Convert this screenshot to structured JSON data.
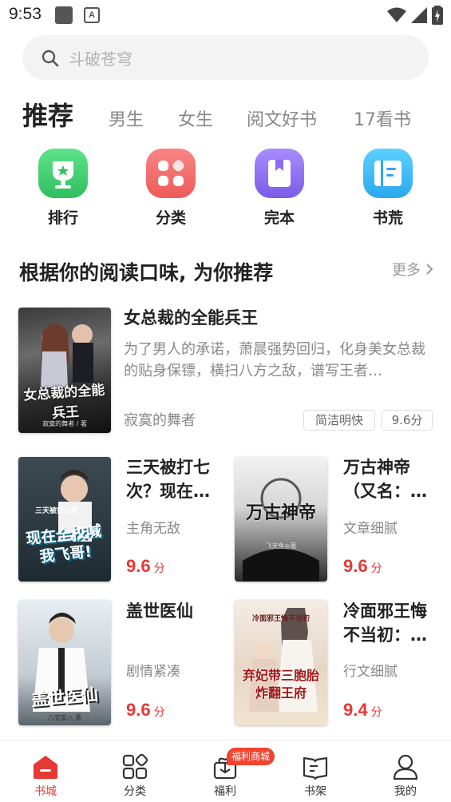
{
  "status_bar": {
    "time": "9:53",
    "a_icon_letter": "A"
  },
  "search": {
    "placeholder": "斗破苍穹"
  },
  "tabs": [
    {
      "label": "推荐",
      "active": true
    },
    {
      "label": "男生"
    },
    {
      "label": "女生"
    },
    {
      "label": "阅文好书"
    },
    {
      "label": "17看书"
    }
  ],
  "quick_entries": [
    {
      "label": "排行",
      "icon": "trophy-icon",
      "color": "#3cc96a"
    },
    {
      "label": "分类",
      "icon": "grid-icon",
      "color": "#f26a6a"
    },
    {
      "label": "完本",
      "icon": "bookmark-book-icon",
      "color": "#8b6cf0"
    },
    {
      "label": "书荒",
      "icon": "open-book-icon",
      "color": "#33b4f5"
    }
  ],
  "section": {
    "title": "根据你的阅读口味, 为你推荐",
    "more": "更多"
  },
  "featured": {
    "title": "女总裁的全能兵王",
    "description": "为了男人的承诺，萧晨强势回归，化身美女总裁的贴身保镖，横扫八方之敌，谱写王者…",
    "author": "寂寞的舞者",
    "tags": [
      "简洁明快",
      "9.6分"
    ],
    "cover_text": "女总裁的全能兵王",
    "cover_author": "寂寞的舞者 / 著"
  },
  "books": [
    {
      "title": "三天被打七次？现在…",
      "subtitle": "主角无敌",
      "score": "9.6",
      "unit": "分",
      "cover_text": "现在全校喊我飞哥!",
      "cover_top": "三天被打七次"
    },
    {
      "title": "万古神帝（又名：…",
      "subtitle": "文章细腻",
      "score": "9.6",
      "unit": "分",
      "cover_text": "万古神帝",
      "cover_author": "飞天鱼◎著"
    },
    {
      "title": "盖世医仙",
      "subtitle": "剧情紧凑",
      "score": "9.6",
      "unit": "分",
      "cover_text": "盖世医仙",
      "cover_author": "八宝饭八 著"
    },
    {
      "title": "冷面邪王悔不当初：…",
      "subtitle": "行文细腻",
      "score": "9.4",
      "unit": "分",
      "cover_text": "弃妃带三胞胎炸翻王府",
      "cover_top": "冷面邪王悔不当初"
    }
  ],
  "bottom_nav": [
    {
      "label": "书城",
      "active": true,
      "icon": "bookstore-icon"
    },
    {
      "label": "分类",
      "icon": "category-grid-icon"
    },
    {
      "label": "福利",
      "icon": "gift-icon"
    },
    {
      "label": "书架",
      "icon": "bookshelf-icon"
    },
    {
      "label": "我的",
      "icon": "profile-icon"
    }
  ],
  "welfare_badge": "福利商城",
  "colors": {
    "accent": "#e53935",
    "badge": "#f0442f"
  }
}
